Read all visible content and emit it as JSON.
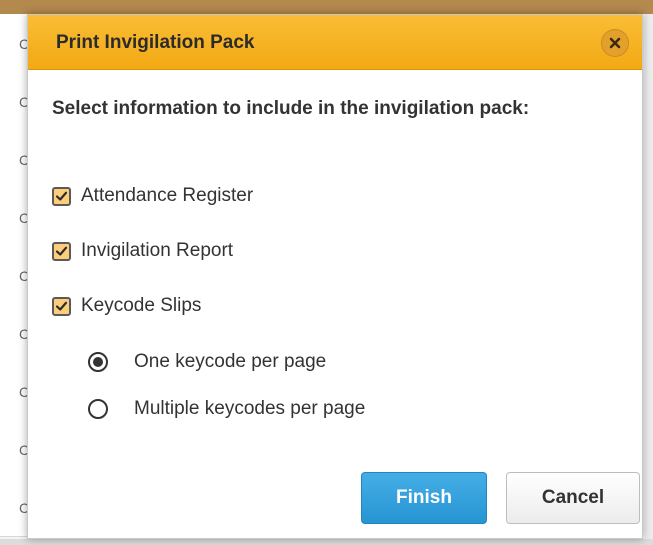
{
  "background": {
    "row_letter": "C",
    "row_count": 9
  },
  "dialog": {
    "title": "Print Invigilation Pack",
    "close_icon": "close-icon",
    "prompt": "Select information to include in the invigilation pack:",
    "checkboxes": [
      {
        "label": "Attendance Register",
        "checked": true
      },
      {
        "label": "Invigilation Report",
        "checked": true
      },
      {
        "label": "Keycode Slips",
        "checked": true
      }
    ],
    "keycode_options": [
      {
        "label": "One keycode per page",
        "selected": true
      },
      {
        "label": "Multiple keycodes per page",
        "selected": false
      }
    ],
    "buttons": {
      "finish": "Finish",
      "cancel": "Cancel"
    }
  },
  "colors": {
    "header": "#f3a914",
    "checkbox_fill": "#fcce7a",
    "primary_button": "#2794d3"
  }
}
